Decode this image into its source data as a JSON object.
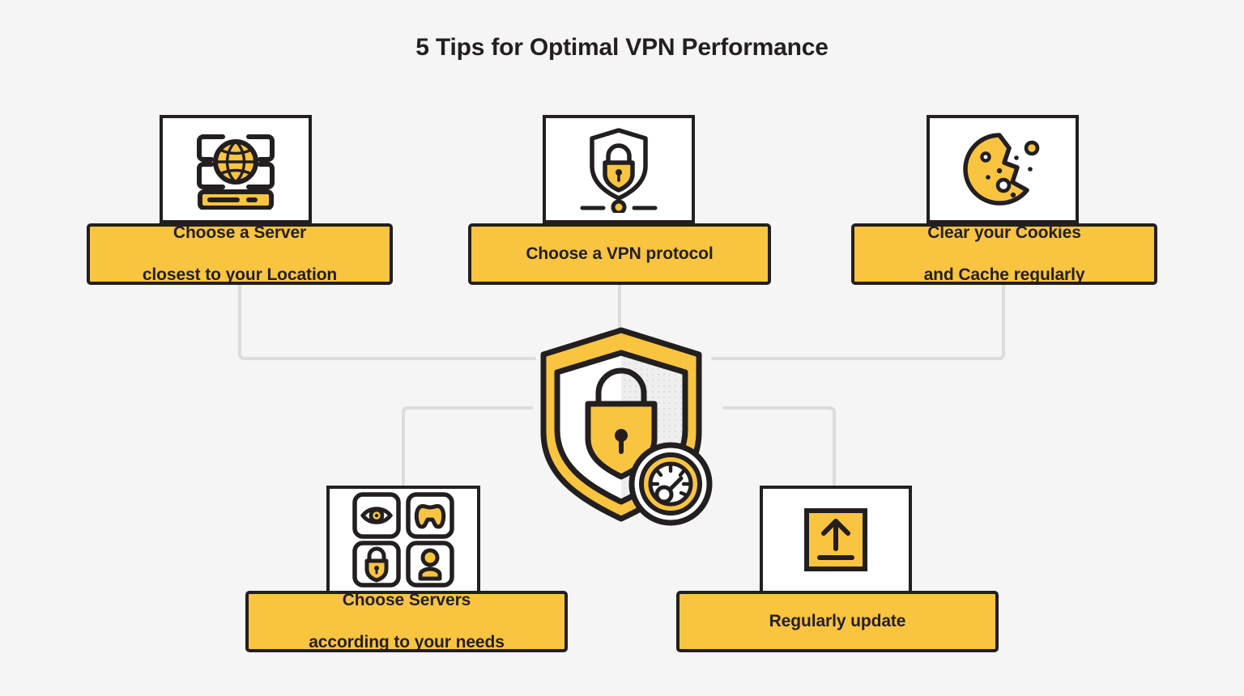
{
  "header": {
    "title": "5 Tips for Optimal VPN Performance"
  },
  "theme": {
    "background": "#f5f5f5",
    "accent_yellow": "#f9c440",
    "ink": "#231f20",
    "card_white": "#ffffff",
    "connector_gray": "#dcdcdc",
    "shield_shade": "#eeeeee"
  },
  "center": {
    "name": "vpn-security-shield",
    "icons": [
      "shield",
      "padlock",
      "speedometer"
    ]
  },
  "tips": [
    {
      "id": "tip-server-location",
      "icon": "server-globe-icon",
      "label_lines": [
        "Choose a Server",
        "closest to your Location"
      ],
      "label_text": "Choose a Server closest to your Location"
    },
    {
      "id": "tip-vpn-protocol",
      "icon": "shield-lock-network-icon",
      "label_lines": [
        "Choose a VPN protocol"
      ],
      "label_text": "Choose a VPN protocol"
    },
    {
      "id": "tip-clear-cookies",
      "icon": "cookie-icon",
      "label_lines": [
        "Clear your Cookies",
        "and Cache regularly"
      ],
      "label_text": "Clear your Cookies and Cache regularly"
    },
    {
      "id": "tip-choose-servers-needs",
      "icon": "app-grid-icon",
      "label_lines": [
        "Choose Servers",
        "according to your needs"
      ],
      "label_text": "Choose Servers according to your needs"
    },
    {
      "id": "tip-regularly-update",
      "icon": "upload-update-icon",
      "label_lines": [
        "Regularly update"
      ],
      "label_text": "Regularly update"
    }
  ]
}
